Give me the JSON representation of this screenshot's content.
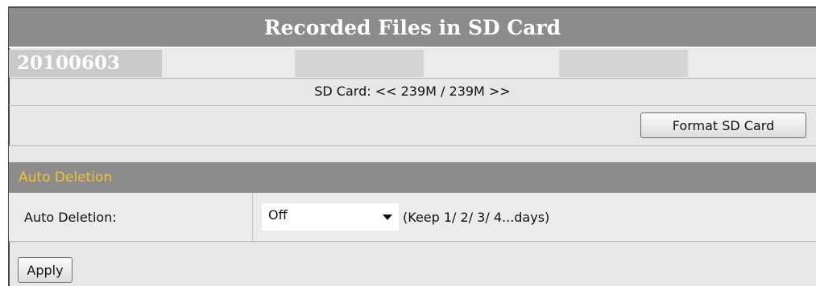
{
  "page": {
    "title": "Recorded Files in SD Card"
  },
  "files": {
    "date": "20100603"
  },
  "sd_card": {
    "usage_text": "SD Card: << 239M / 239M >>",
    "format_button": "Format SD Card"
  },
  "auto_deletion": {
    "section_title": "Auto Deletion",
    "label": "Auto Deletion:",
    "selected_value": "Off",
    "hint": "(Keep 1/ 2/ 3/ 4...days)"
  },
  "actions": {
    "apply_label": "Apply"
  },
  "colors": {
    "header_bg": "#8c8c8c",
    "section_title_text": "#f4c132",
    "panel_bg": "#e7e7e7"
  }
}
